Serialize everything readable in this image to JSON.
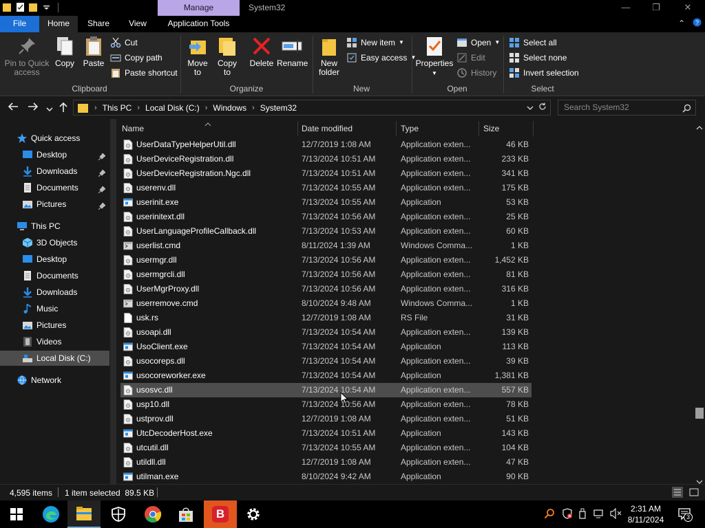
{
  "window": {
    "title": "System32",
    "context_tab": "Manage",
    "controls": {
      "minimize": "—",
      "maximize": "❐",
      "close": "✕"
    }
  },
  "ribbon_tabs": {
    "file": "File",
    "home": "Home",
    "share": "Share",
    "view": "View",
    "app_tools": "Application Tools"
  },
  "ribbon": {
    "clipboard": {
      "label": "Clipboard",
      "pin": "Pin to Quick access",
      "copy": "Copy",
      "paste": "Paste",
      "cut": "Cut",
      "copy_path": "Copy path",
      "paste_shortcut": "Paste shortcut"
    },
    "organize": {
      "label": "Organize",
      "move_to": "Move to",
      "copy_to": "Copy to",
      "delete": "Delete",
      "rename": "Rename"
    },
    "new": {
      "label": "New",
      "new_folder": "New folder",
      "new_item": "New item",
      "easy_access": "Easy access"
    },
    "open": {
      "label": "Open",
      "properties": "Properties",
      "open": "Open",
      "edit": "Edit",
      "history": "History"
    },
    "select": {
      "label": "Select",
      "select_all": "Select all",
      "select_none": "Select none",
      "invert": "Invert selection"
    }
  },
  "address": {
    "crumbs": [
      "This PC",
      "Local Disk (C:)",
      "Windows",
      "System32"
    ],
    "search_placeholder": "Search System32"
  },
  "nav": {
    "quick_access": "Quick access",
    "qa_items": [
      "Desktop",
      "Downloads",
      "Documents",
      "Pictures"
    ],
    "this_pc": "This PC",
    "pc_items": [
      "3D Objects",
      "Desktop",
      "Documents",
      "Downloads",
      "Music",
      "Pictures",
      "Videos",
      "Local Disk (C:)"
    ],
    "network": "Network"
  },
  "columns": {
    "name": "Name",
    "date": "Date modified",
    "type": "Type",
    "size": "Size"
  },
  "files": [
    {
      "name": "UserDataTypeHelperUtil.dll",
      "date": "12/7/2019 1:08 AM",
      "type": "Application exten...",
      "size": "46 KB",
      "kind": "dll"
    },
    {
      "name": "UserDeviceRegistration.dll",
      "date": "7/13/2024 10:51 AM",
      "type": "Application exten...",
      "size": "233 KB",
      "kind": "dll"
    },
    {
      "name": "UserDeviceRegistration.Ngc.dll",
      "date": "7/13/2024 10:51 AM",
      "type": "Application exten...",
      "size": "341 KB",
      "kind": "dll"
    },
    {
      "name": "userenv.dll",
      "date": "7/13/2024 10:55 AM",
      "type": "Application exten...",
      "size": "175 KB",
      "kind": "dll"
    },
    {
      "name": "userinit.exe",
      "date": "7/13/2024 10:55 AM",
      "type": "Application",
      "size": "53 KB",
      "kind": "exe"
    },
    {
      "name": "userinitext.dll",
      "date": "7/13/2024 10:56 AM",
      "type": "Application exten...",
      "size": "25 KB",
      "kind": "dll"
    },
    {
      "name": "UserLanguageProfileCallback.dll",
      "date": "7/13/2024 10:53 AM",
      "type": "Application exten...",
      "size": "60 KB",
      "kind": "dll"
    },
    {
      "name": "userlist.cmd",
      "date": "8/11/2024 1:39 AM",
      "type": "Windows Comma...",
      "size": "1 KB",
      "kind": "cmd"
    },
    {
      "name": "usermgr.dll",
      "date": "7/13/2024 10:56 AM",
      "type": "Application exten...",
      "size": "1,452 KB",
      "kind": "dll"
    },
    {
      "name": "usermgrcli.dll",
      "date": "7/13/2024 10:56 AM",
      "type": "Application exten...",
      "size": "81 KB",
      "kind": "dll"
    },
    {
      "name": "UserMgrProxy.dll",
      "date": "7/13/2024 10:56 AM",
      "type": "Application exten...",
      "size": "316 KB",
      "kind": "dll"
    },
    {
      "name": "userremove.cmd",
      "date": "8/10/2024 9:48 AM",
      "type": "Windows Comma...",
      "size": "1 KB",
      "kind": "cmd"
    },
    {
      "name": "usk.rs",
      "date": "12/7/2019 1:08 AM",
      "type": "RS File",
      "size": "31 KB",
      "kind": "file"
    },
    {
      "name": "usoapi.dll",
      "date": "7/13/2024 10:54 AM",
      "type": "Application exten...",
      "size": "139 KB",
      "kind": "dll"
    },
    {
      "name": "UsoClient.exe",
      "date": "7/13/2024 10:54 AM",
      "type": "Application",
      "size": "113 KB",
      "kind": "exe"
    },
    {
      "name": "usocoreps.dll",
      "date": "7/13/2024 10:54 AM",
      "type": "Application exten...",
      "size": "39 KB",
      "kind": "dll"
    },
    {
      "name": "usocoreworker.exe",
      "date": "7/13/2024 10:54 AM",
      "type": "Application",
      "size": "1,381 KB",
      "kind": "exe"
    },
    {
      "name": "usosvc.dll",
      "date": "7/13/2024 10:54 AM",
      "type": "Application exten...",
      "size": "557 KB",
      "kind": "dll",
      "selected": true
    },
    {
      "name": "usp10.dll",
      "date": "7/13/2024 10:56 AM",
      "type": "Application exten...",
      "size": "78 KB",
      "kind": "dll"
    },
    {
      "name": "ustprov.dll",
      "date": "12/7/2019 1:08 AM",
      "type": "Application exten...",
      "size": "51 KB",
      "kind": "dll"
    },
    {
      "name": "UtcDecoderHost.exe",
      "date": "7/13/2024 10:51 AM",
      "type": "Application",
      "size": "143 KB",
      "kind": "exe"
    },
    {
      "name": "utcutil.dll",
      "date": "7/13/2024 10:55 AM",
      "type": "Application exten...",
      "size": "104 KB",
      "kind": "dll"
    },
    {
      "name": "utildll.dll",
      "date": "12/7/2019 1:08 AM",
      "type": "Application exten...",
      "size": "47 KB",
      "kind": "dll"
    },
    {
      "name": "utilman.exe",
      "date": "8/10/2024 9:42 AM",
      "type": "Application",
      "size": "90 KB",
      "kind": "exe"
    }
  ],
  "status": {
    "items": "4,595 items",
    "selected": "1 item selected  89.5 KB"
  },
  "taskbar": {
    "time": "2:31 AM",
    "date": "8/11/2024",
    "notifications": "3",
    "b_app": "B"
  },
  "colors": {
    "accent": "#1b6fd6",
    "manage_tab": "#b9a6e6",
    "selection": "#4d4d4d",
    "background": "#191919"
  }
}
